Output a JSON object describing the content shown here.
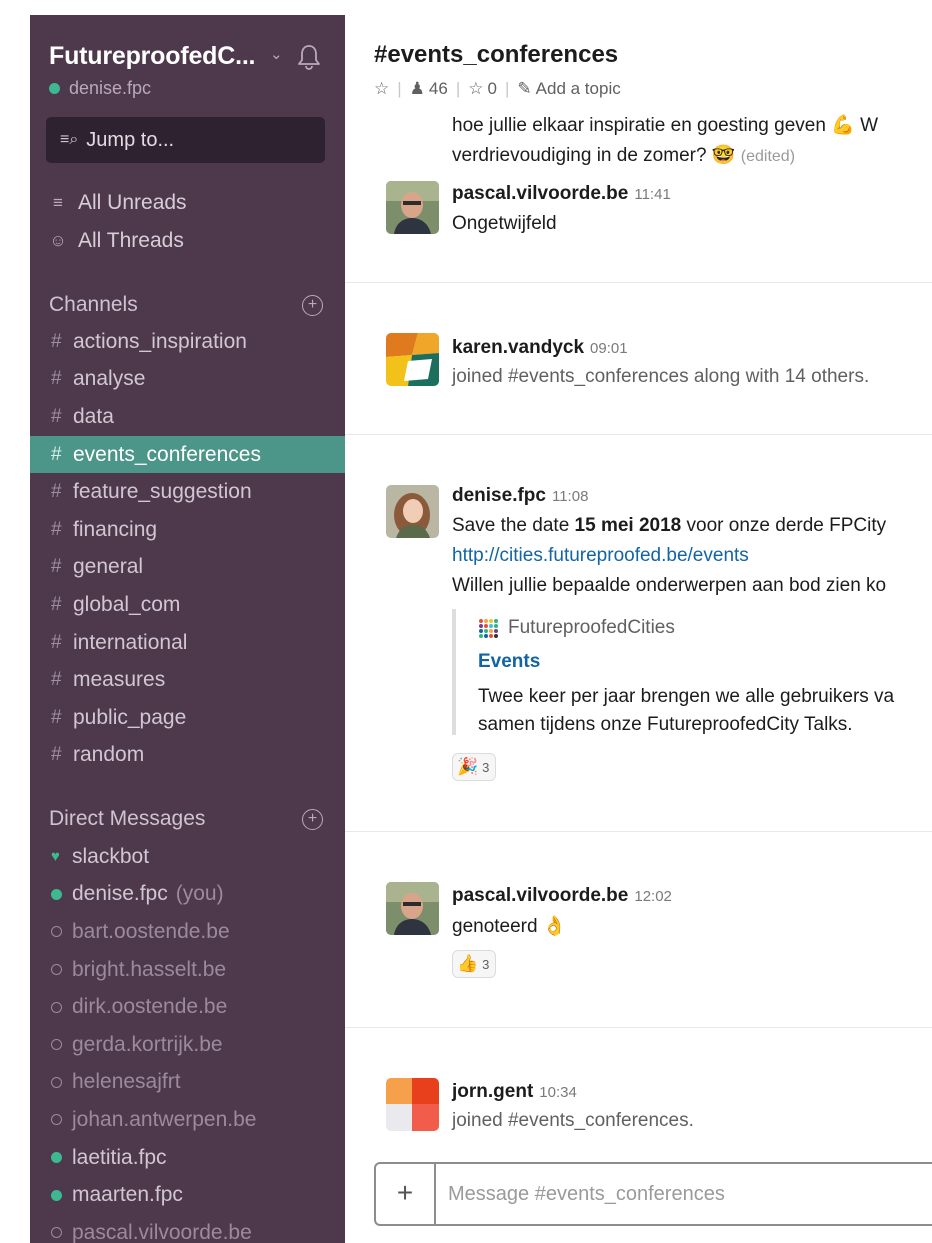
{
  "sidebar": {
    "team_name": "FutureproofedC...",
    "user": "denise.fpc",
    "jump_label": "Jump to...",
    "all_unreads": "All Unreads",
    "all_threads": "All Threads",
    "channels_label": "Channels",
    "channels": [
      {
        "name": "actions_inspiration",
        "active": false
      },
      {
        "name": "analyse",
        "active": false
      },
      {
        "name": "data",
        "active": false
      },
      {
        "name": "events_conferences",
        "active": true
      },
      {
        "name": "feature_suggestion",
        "active": false
      },
      {
        "name": "financing",
        "active": false
      },
      {
        "name": "general",
        "active": false
      },
      {
        "name": "global_com",
        "active": false
      },
      {
        "name": "international",
        "active": false
      },
      {
        "name": "measures",
        "active": false
      },
      {
        "name": "public_page",
        "active": false
      },
      {
        "name": "random",
        "active": false
      }
    ],
    "dm_label": "Direct Messages",
    "direct_messages": [
      {
        "name": "slackbot",
        "presence": "heart"
      },
      {
        "name": "denise.fpc",
        "presence": "on",
        "suffix": "(you)"
      },
      {
        "name": "bart.oostende.be",
        "presence": "off"
      },
      {
        "name": "bright.hasselt.be",
        "presence": "off"
      },
      {
        "name": "dirk.oostende.be",
        "presence": "off"
      },
      {
        "name": "gerda.kortrijk.be",
        "presence": "off"
      },
      {
        "name": "helenesajfrt",
        "presence": "off"
      },
      {
        "name": "johan.antwerpen.be",
        "presence": "off"
      },
      {
        "name": "laetitia.fpc",
        "presence": "on"
      },
      {
        "name": "maarten.fpc",
        "presence": "on"
      },
      {
        "name": "pascal.vilvoorde.be",
        "presence": "off"
      }
    ]
  },
  "header": {
    "channel_title": "#events_conferences",
    "member_count": "46",
    "pinned_count": "0",
    "add_topic": "Add a topic"
  },
  "messages": {
    "partial_line1": "hoe jullie elkaar inspiratie en goesting geven",
    "partial_line1_tail": "W",
    "partial_line2": "verdrievoudiging in de zomer?",
    "edited_label": "(edited)",
    "m1": {
      "author": "pascal.vilvoorde.be",
      "time": "11:41",
      "text": "Ongetwijfeld"
    },
    "m2": {
      "author": "karen.vandyck",
      "time": "09:01",
      "text": "joined #events_conferences along with 14 others."
    },
    "m3": {
      "author": "denise.fpc",
      "time": "11:08",
      "line1_pre": "Save the date ",
      "line1_bold": "15 mei 2018",
      "line1_post": " voor onze derde FPCity",
      "link": "http://cities.futureproofed.be/events",
      "line3": "Willen jullie bepaalde onderwerpen aan bod zien ko",
      "attachment": {
        "source": "FutureproofedCities",
        "title": "Events",
        "body1": "Twee keer per jaar brengen we alle gebruikers va",
        "body2": "samen tijdens onze FutureproofedCity Talks."
      },
      "reaction_count": "3"
    },
    "m4": {
      "author": "pascal.vilvoorde.be",
      "time": "12:02",
      "text": "genoteerd",
      "reaction_count": "3"
    },
    "m5": {
      "author": "jorn.gent",
      "time": "10:34",
      "text": "joined #events_conferences."
    }
  },
  "composer": {
    "plus": "+",
    "placeholder": "Message #events_conferences"
  }
}
